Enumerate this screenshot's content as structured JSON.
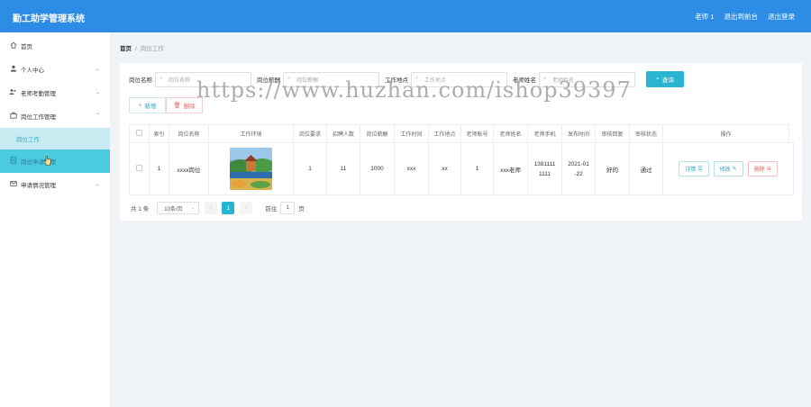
{
  "header": {
    "title": "勤工助学管理系统",
    "user": "老师 1",
    "back_link": "退出到前台",
    "logout": "退出登录"
  },
  "sidebar": {
    "items": [
      {
        "label": "首页",
        "icon": "home-icon"
      },
      {
        "label": "个人中心",
        "icon": "user-icon"
      },
      {
        "label": "老师考勤管理",
        "icon": "people-icon"
      },
      {
        "label": "岗位工作管理",
        "icon": "briefcase-icon"
      },
      {
        "label": "岗位工作",
        "sub": true
      },
      {
        "label": "岗位申请管理",
        "icon": "document-icon"
      },
      {
        "label": "申请情况管理",
        "icon": "mail-icon"
      }
    ]
  },
  "breadcrumb": {
    "home": "首页",
    "separator": "/",
    "current": "岗位工作"
  },
  "search": {
    "fields": [
      {
        "label": "岗位名称",
        "placeholder": "岗位名称"
      },
      {
        "label": "岗位薪酬",
        "placeholder": "岗位薪酬"
      },
      {
        "label": "工作地点",
        "placeholder": "工作地点"
      },
      {
        "label": "老师姓名",
        "placeholder": "老师姓名"
      }
    ],
    "button": "查询"
  },
  "actions": {
    "add": "新增",
    "delete": "删除"
  },
  "table": {
    "columns": [
      "索引",
      "岗位名称",
      "工作环境",
      "岗位要求",
      "招聘人数",
      "岗位薪酬",
      "工作时间",
      "工作地点",
      "老师账号",
      "老师姓名",
      "老师手机",
      "发布时间",
      "审核回复",
      "审核状态",
      "操作"
    ],
    "rows": [
      {
        "index": "1",
        "name": "xxxx岗位",
        "requirement": "1",
        "headcount": "11",
        "salary": "1000",
        "time": "xxx",
        "place": "xx",
        "account": "1",
        "teacher": "xxx老师",
        "phone": "1381111 1111",
        "date": "2021-01 -22",
        "reply": "好的",
        "status": "通过",
        "op_detail": "详情",
        "op_edit": "修改",
        "op_delete": "删除"
      }
    ]
  },
  "pager": {
    "total": "共 1 条",
    "page_size": "10条/页",
    "current_page": "1",
    "goto_label": "前往",
    "goto_value": "1",
    "page_suffix": "页"
  },
  "watermark": "https://www.huzhan.com/ishop39397",
  "colors": {
    "header": "#2d8ce6",
    "accent": "#29b5cf",
    "danger": "#e05a5a"
  }
}
